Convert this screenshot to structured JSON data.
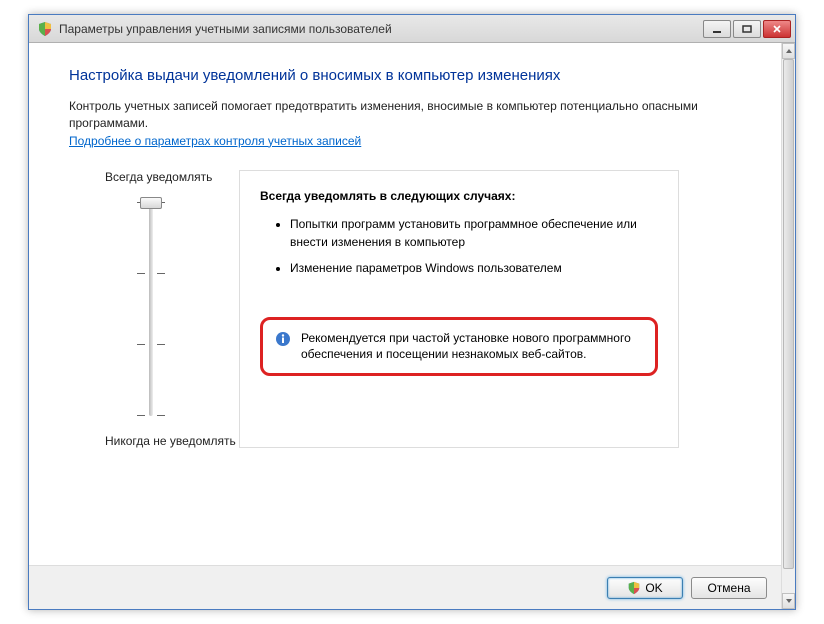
{
  "window": {
    "title": "Параметры управления учетными записями пользователей"
  },
  "page": {
    "heading": "Настройка выдачи уведомлений о вносимых в компьютер изменениях",
    "description": "Контроль учетных записей помогает предотвратить изменения, вносимые в компьютер потенциально опасными программами.",
    "help_link": "Подробнее о параметрах контроля учетных записей"
  },
  "slider": {
    "top_label": "Всегда уведомлять",
    "bottom_label": "Никогда не уведомлять",
    "position": 0,
    "levels": 4
  },
  "info_panel": {
    "title": "Всегда уведомлять в следующих случаях:",
    "bullets": [
      "Попытки программ установить программное обеспечение или внести изменения в компьютер",
      "Изменение параметров Windows пользователем"
    ],
    "recommendation": "Рекомендуется при частой установке нового программного обеспечения и посещении незнакомых веб-сайтов."
  },
  "buttons": {
    "ok": "OK",
    "cancel": "Отмена"
  }
}
